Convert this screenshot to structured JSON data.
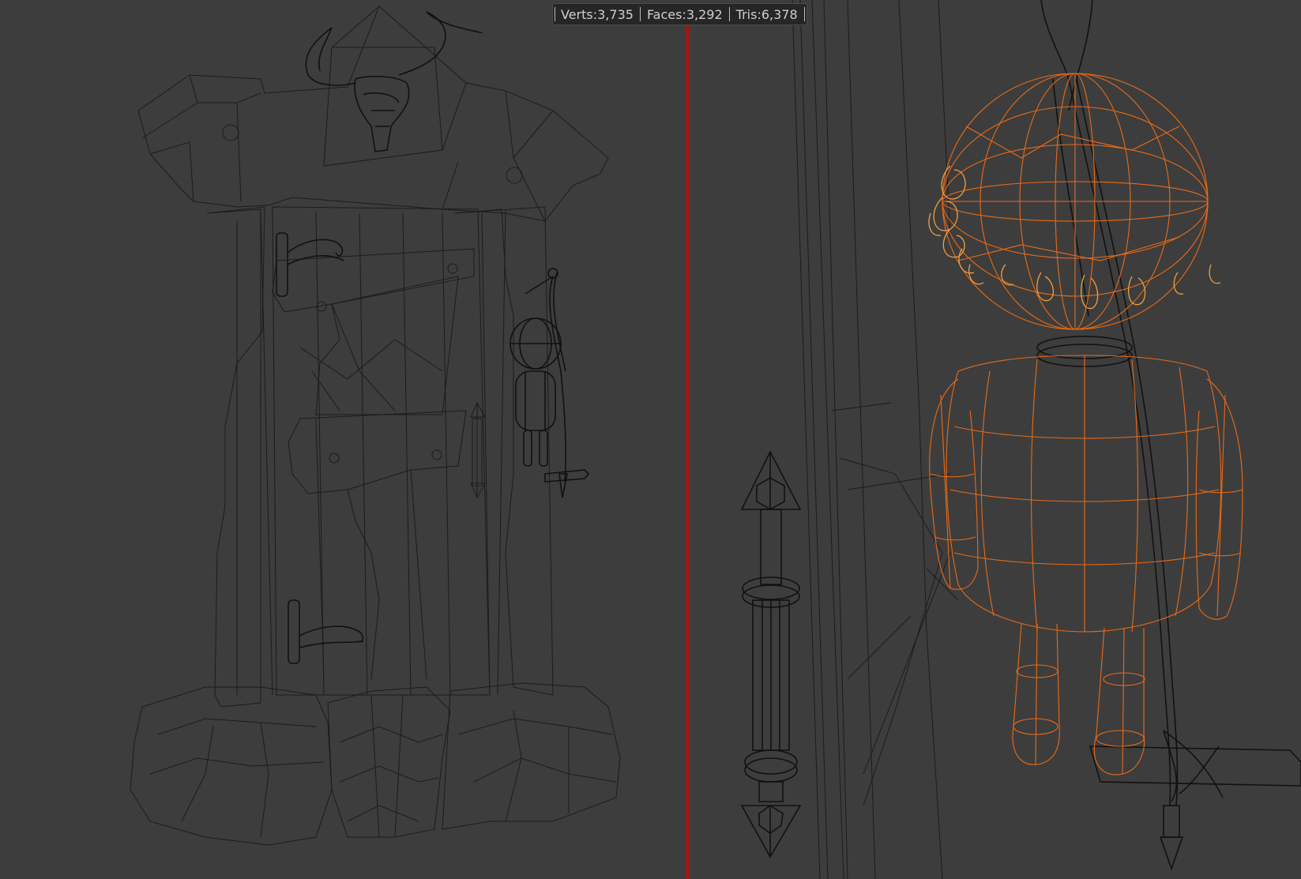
{
  "stats": {
    "verts": "Verts:3,735",
    "faces": "Faces:3,292",
    "tris": "Tris:6,378"
  },
  "colors": {
    "background": "#3d3d3d",
    "wireframe": "#1c1c1c",
    "selected_wireframe": "#ea6a16",
    "divider": "#a0141c"
  },
  "icons": {
    "left_model": "door-wireframe",
    "right_model": "doll-wireframe-selected"
  }
}
